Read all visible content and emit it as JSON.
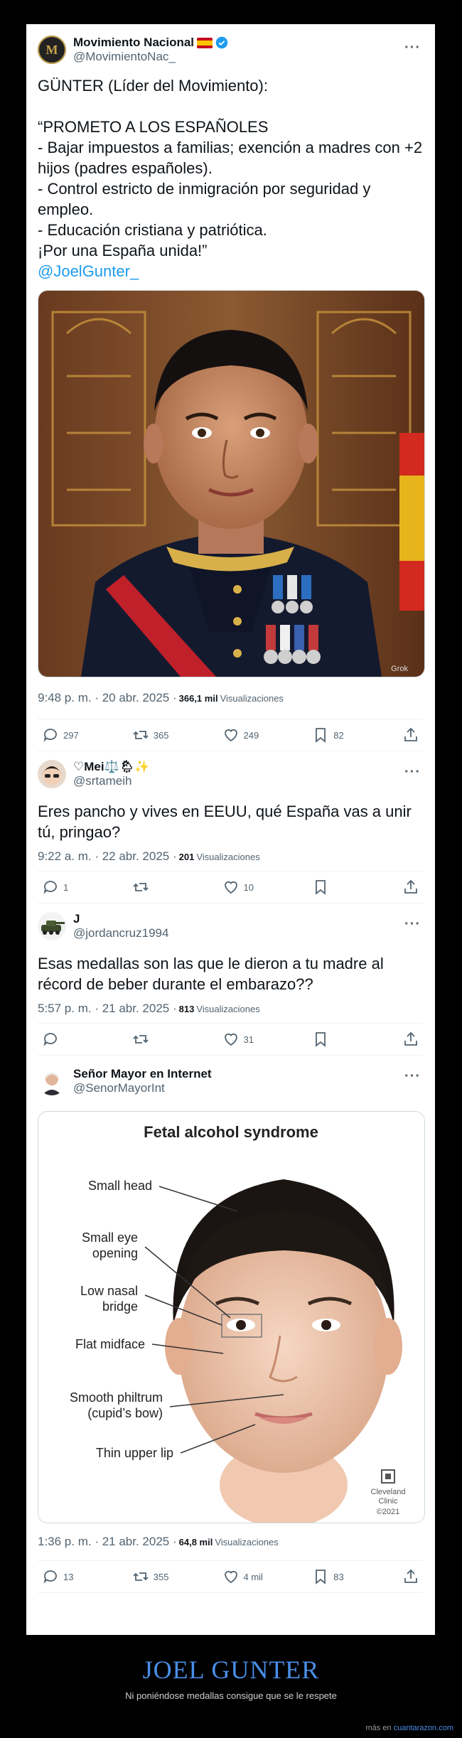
{
  "tweets": [
    {
      "name": "Movimiento Nacional",
      "flag": "🇪🇸",
      "handle": "@MovimientoNac_",
      "text": "GÜNTER (Líder del Movimiento):\n\n“PROMETO A LOS ESPAÑOLES\n- Bajar impuestos a familias; exención a madres con +2 hijos (padres españoles).\n- Control estricto de inmigración por seguridad y empleo.\n- Educación cristiana y patriótica.\n¡Por una España unida!”",
      "mention": "@JoelGunter_",
      "time": "9:48 p. m. · 20 abr. 2025 ·",
      "views_count": "366,1 mil",
      "views_label": "Visualizaciones",
      "image_corner_text": "Grok",
      "replies": "297",
      "retweets": "365",
      "likes": "249",
      "bookmarks": "82"
    },
    {
      "name": "♡Mei⚖️🌦✨",
      "handle": "@srtameih",
      "text": "Eres pancho y vives en EEUU, qué España vas a unir tú, pringao?",
      "time": "9:22 a. m. · 22 abr. 2025 ·",
      "views_count": "201",
      "views_label": "Visualizaciones",
      "replies": "1",
      "retweets": "",
      "likes": "10",
      "bookmarks": ""
    },
    {
      "name": "J",
      "handle": "@jordancruz1994",
      "text": "Esas medallas son las que le dieron a tu madre al récord de beber durante el embarazo??",
      "time": "5:57 p. m. · 21 abr. 2025 ·",
      "views_count": "813",
      "views_label": "Visualizaciones",
      "replies": "",
      "retweets": "",
      "likes": "31",
      "bookmarks": ""
    },
    {
      "name": "Señor Mayor en Internet",
      "handle": "@SenorMayorInt",
      "time": "1:36 p. m. · 21 abr. 2025 ·",
      "views_count": "64,8 mil",
      "views_label": "Visualizaciones",
      "replies": "13",
      "retweets": "355",
      "likes": "4 mil",
      "bookmarks": "83",
      "diagram": {
        "title": "Fetal alcohol syndrome",
        "labels": [
          "Small head",
          "Small eye",
          "opening",
          "Low nasal",
          "bridge",
          "Flat midface",
          "Smooth philtrum",
          "(cupid’s bow)",
          "Thin upper lip"
        ],
        "brand_line1": "Cleveland",
        "brand_line2": "Clinic",
        "brand_year": "©2021"
      }
    }
  ],
  "footer": {
    "title": "JOEL GUNTER",
    "subtitle": "Ni poniéndose medallas consigue que se le respete",
    "source_prefix": "más en",
    "source_site": "cuantarazon.com"
  },
  "colors": {
    "accent": "#1d9bf0",
    "verified": "#1d9bf0",
    "footer_title": "#4a8ee8",
    "background": "#000000"
  }
}
